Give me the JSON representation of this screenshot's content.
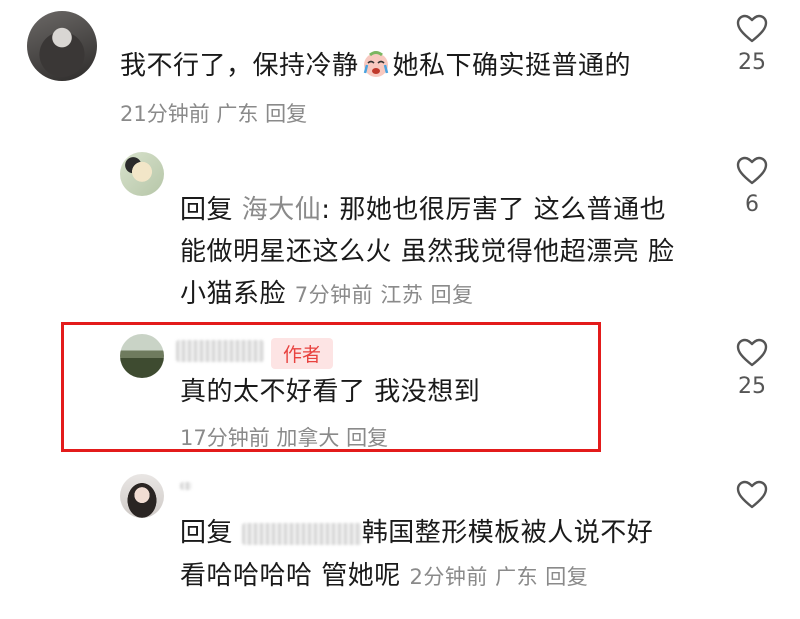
{
  "comments": [
    {
      "text_before": "我不行了，保持冷静",
      "emoji": "crying-face-emoji",
      "text_after": "她私下确实挺普通的",
      "meta": "21分钟前 广东 回复",
      "likes": "25"
    },
    {
      "reply_prefix": "回复",
      "reply_to": "海大仙",
      "line1": ": 那她也很厉害了 这么普通也",
      "line2": "能做明星还这么火 虽然我觉得他超漂亮 脸",
      "line3": "小猫系脸",
      "meta": "7分钟前 江苏 回复",
      "likes": "6"
    },
    {
      "author_badge": "作者",
      "text": "真的太不好看了 我没想到",
      "meta": "17分钟前 加拿大 回复",
      "likes": "25"
    },
    {
      "reply_prefix": "回复",
      "line1_after": "韩国整形模板被人说不好",
      "line2": "看哈哈哈哈  管她呢",
      "meta": "2分钟前 广东 回复"
    }
  ],
  "colors": {
    "highlight": "#e31b1b",
    "badge_text": "#e8423f",
    "badge_bg": "#fde4e4",
    "meta": "#8a8a8a"
  },
  "icons": [
    "heart-outline-icon",
    "crying-face-emoji"
  ]
}
